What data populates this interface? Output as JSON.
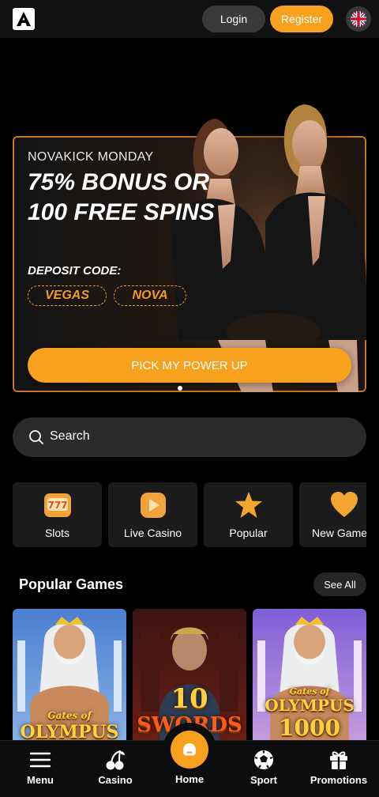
{
  "header": {
    "logo_icon": "brand-logo-icon",
    "login_label": "Login",
    "register_label": "Register",
    "language_icon": "uk-flag-icon",
    "accent": "#f7a11f"
  },
  "banner": {
    "kicker": "NOVAKICK MONDAY",
    "headline_line1": "75% BONUS OR",
    "headline_line2": "100 FREE SPINS",
    "code_label": "DEPOSIT CODE:",
    "codes": [
      "VEGAS",
      "NOVA"
    ],
    "cta_label": "PICK MY POWER UP",
    "slide_count": 1,
    "active_slide": 1
  },
  "search": {
    "label": "Search",
    "icon": "search-icon"
  },
  "categories": [
    {
      "label": "Slots",
      "icon": "slot-machine-icon"
    },
    {
      "label": "Live Casino",
      "icon": "play-icon"
    },
    {
      "label": "Popular",
      "icon": "star-icon"
    },
    {
      "label": "New Games",
      "icon": "heart-icon"
    }
  ],
  "popular_games": {
    "title": "Popular Games",
    "see_all_label": "See All",
    "games": [
      {
        "title_line1": "Gates of",
        "title_line2": "OLYMPUS"
      },
      {
        "title_line1": "10",
        "title_line2": "SWORDS"
      },
      {
        "title_line1": "Gates of",
        "title_line2": "OLYMPUS",
        "title_line3": "1000"
      }
    ]
  },
  "bottom_nav": [
    {
      "label": "Menu",
      "icon": "hamburger-icon"
    },
    {
      "label": "Casino",
      "icon": "cherries-icon"
    },
    {
      "label": "Home",
      "icon": "home-icon"
    },
    {
      "label": "Sport",
      "icon": "soccer-ball-icon"
    },
    {
      "label": "Promotions",
      "icon": "gift-icon"
    }
  ]
}
